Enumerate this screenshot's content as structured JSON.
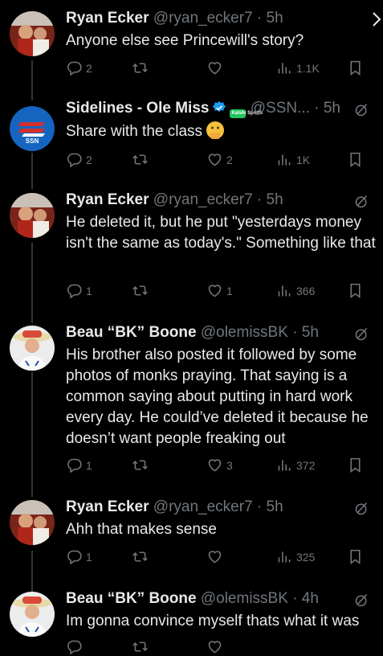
{
  "tweets": [
    {
      "name": "Ryan Ecker",
      "handle": "@ryan_ecker7",
      "sep": "·",
      "time": "5h",
      "text": "Anyone else see Princewill's story?",
      "replies": "2",
      "retweets": "",
      "likes": "",
      "views": "1.1K"
    },
    {
      "name": "Sidelines - Ole Miss",
      "badge": "Kalshi Sports",
      "handle": "@SSN...",
      "sep": "·",
      "time": "5h",
      "text": "Share with the class",
      "replies": "2",
      "retweets": "",
      "likes": "2",
      "views": "1K"
    },
    {
      "name": "Ryan Ecker",
      "handle": "@ryan_ecker7",
      "sep": "·",
      "time": "5h",
      "text": "He deleted it, but he put \"yesterdays money isn't the same as today's.\" Something like that",
      "replies": "1",
      "retweets": "",
      "likes": "1",
      "views": "366"
    },
    {
      "name": "Beau “BK” Boone",
      "handle": "@olemissBK",
      "sep": "·",
      "time": "5h",
      "text": "His brother also posted it followed by some photos of monks praying. That saying is a common saying about putting in hard work every day. He could’ve deleted it because he doesn’t want people freaking out",
      "replies": "1",
      "retweets": "",
      "likes": "3",
      "views": "372"
    },
    {
      "name": "Ryan Ecker",
      "handle": "@ryan_ecker7",
      "sep": "·",
      "time": "5h",
      "text": "Ahh that makes sense",
      "replies": "1",
      "retweets": "",
      "likes": "",
      "views": "325"
    },
    {
      "name": "Beau “BK” Boone",
      "handle": "@olemissBK",
      "sep": "·",
      "time": "4h",
      "text": "Im gonna convince myself thats what it was"
    }
  ],
  "colors": {
    "background": "#000000",
    "text": "#e7e9ea",
    "secondary": "#71767b",
    "verified": "#1d9bf0",
    "thread_line": "#333639"
  },
  "icons": [
    "reply-icon",
    "retweet-icon",
    "like-icon",
    "views-icon",
    "bookmark-icon",
    "grok-icon",
    "verified-icon",
    "close-icon"
  ]
}
